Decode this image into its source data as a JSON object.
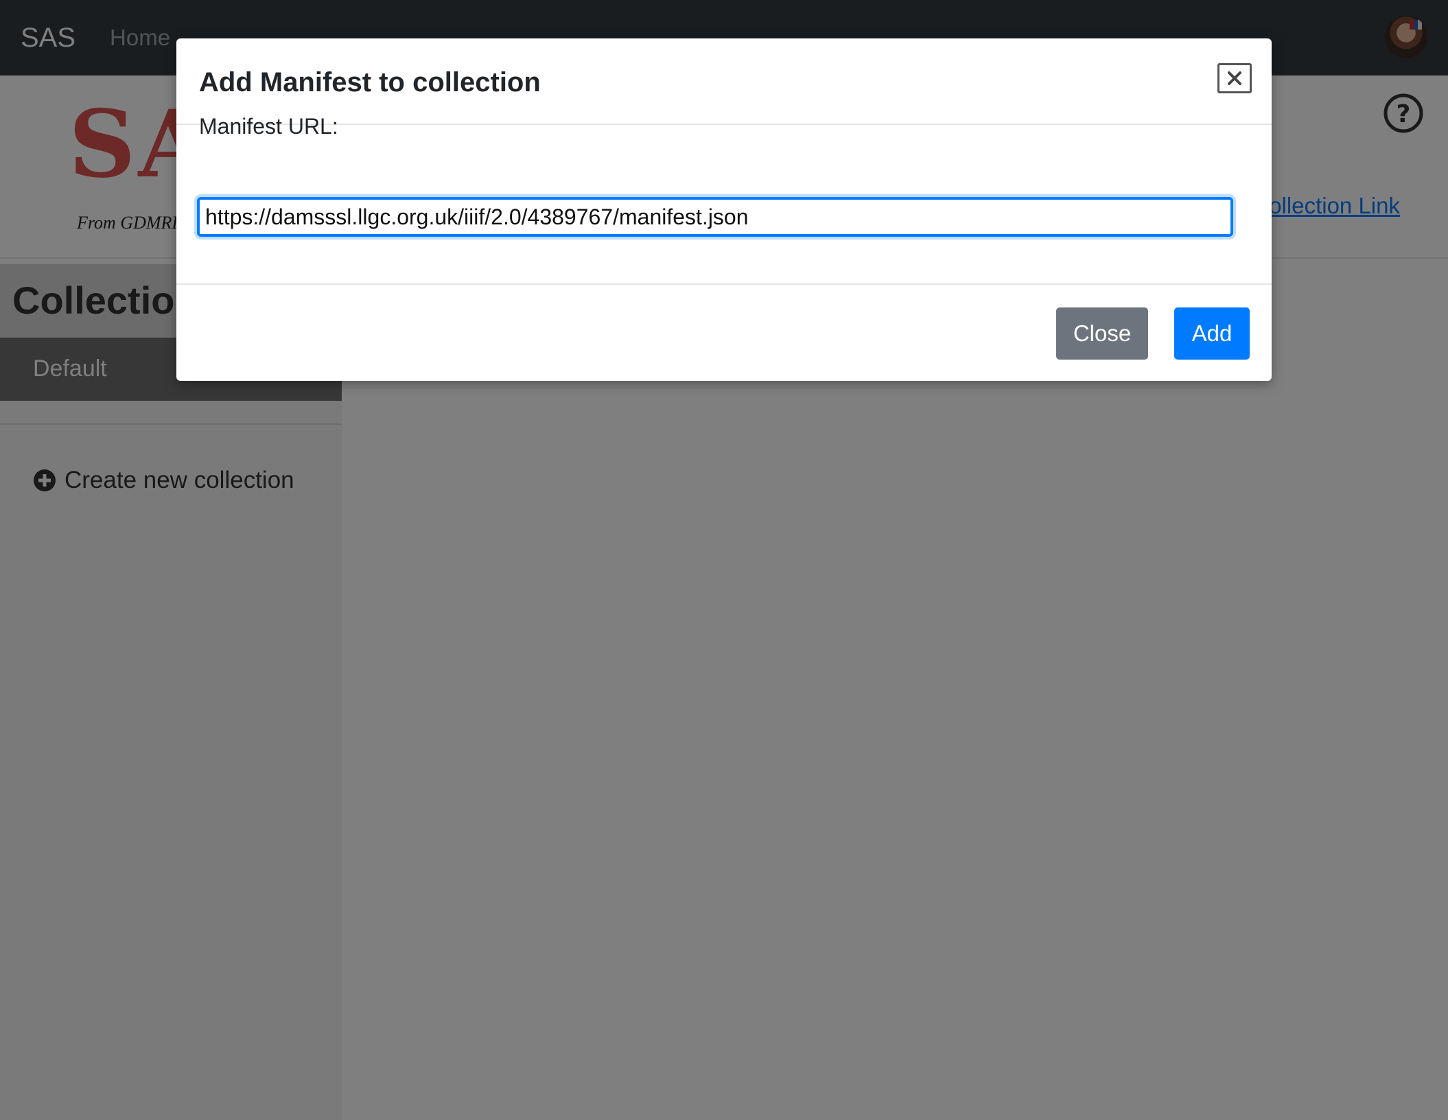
{
  "navbar": {
    "brand": "SAS",
    "home_label": "Home"
  },
  "header": {
    "logo_text": "SAS",
    "logo_subtitle": "From GDMRB",
    "collection_link": "Collection Link"
  },
  "sidebar": {
    "title": "Collections",
    "default_item": "Default",
    "create_label": "Create new collection"
  },
  "modal": {
    "title": "Add Manifest to collection",
    "field_label": "Manifest URL:",
    "url_value": "https://damsssl.llgc.org.uk/iiif/2.0/4389767/manifest.json",
    "close_button": "Close",
    "add_button": "Add"
  },
  "colors": {
    "navbar": "#343a40",
    "primary": "#007bff",
    "secondary": "#6c757d",
    "logo_red": "#d9534f"
  },
  "icons": [
    "user-avatar",
    "help-icon",
    "plus-circle-icon",
    "close-x-icon"
  ]
}
